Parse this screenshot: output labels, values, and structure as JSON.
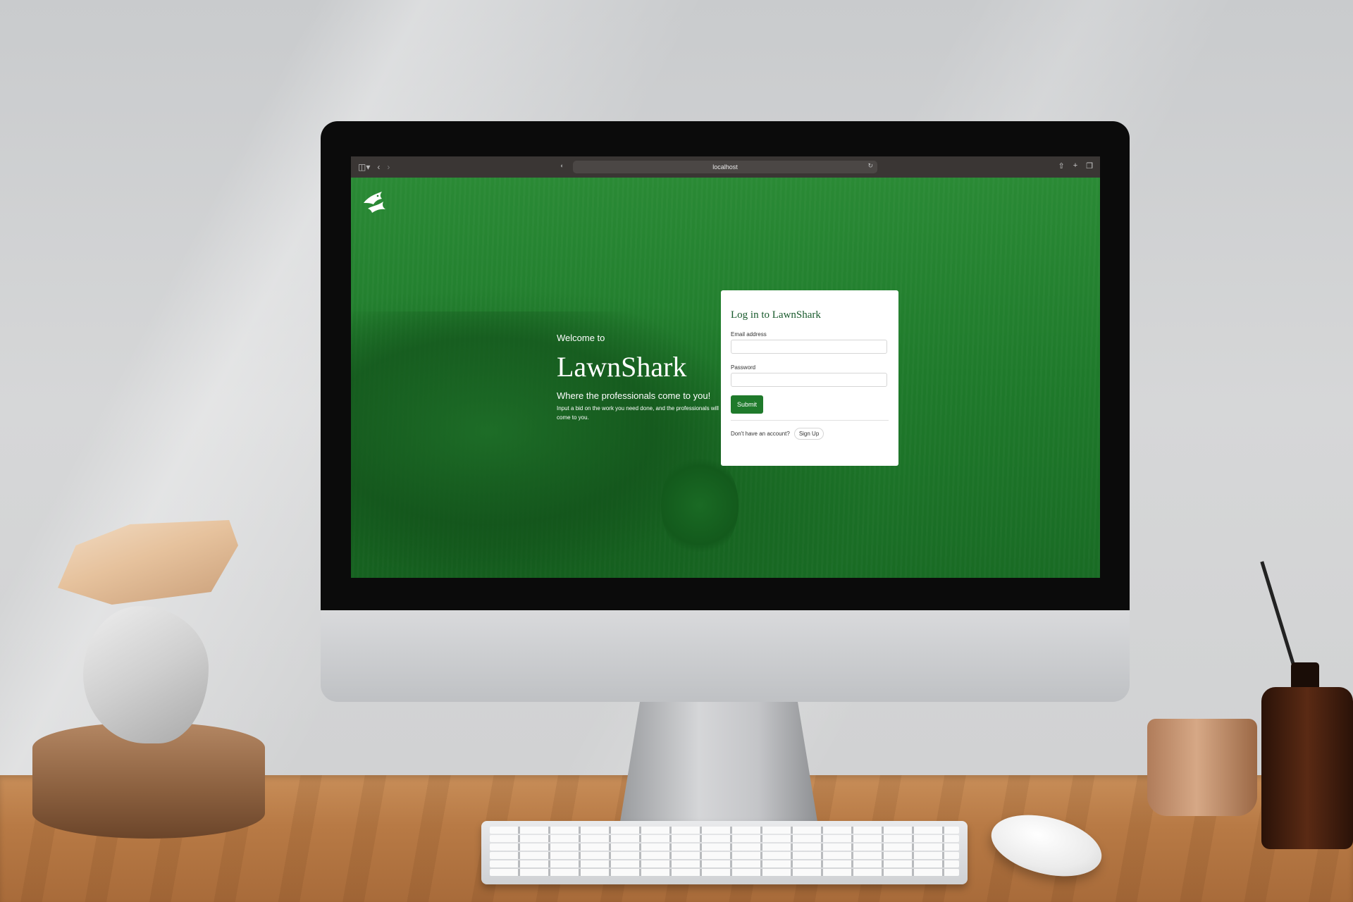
{
  "browser": {
    "address": "localhost",
    "icons": {
      "sidebar": "sidebar-toggle-icon",
      "back": "chevron-left-icon",
      "forward": "chevron-right-icon",
      "reload": "reload-icon",
      "share": "share-icon",
      "new_tab": "plus-icon",
      "tabs": "tabs-overview-icon"
    }
  },
  "brand": {
    "logo_icon": "shark-logo-icon",
    "primary_color": "#1f7a2b",
    "title_color": "#17592b"
  },
  "hero": {
    "welcome": "Welcome to",
    "title": "LawnShark",
    "tagline": "Where the professionals come to you!",
    "description": "Input a bid on the work you need done, and the professionals will come to you."
  },
  "login": {
    "title": "Log in to LawnShark",
    "email_label": "Email address",
    "email_value": "",
    "password_label": "Password",
    "password_value": "",
    "submit_label": "Submit",
    "no_account_text": "Don't have an account?",
    "signup_label": "Sign Up"
  }
}
